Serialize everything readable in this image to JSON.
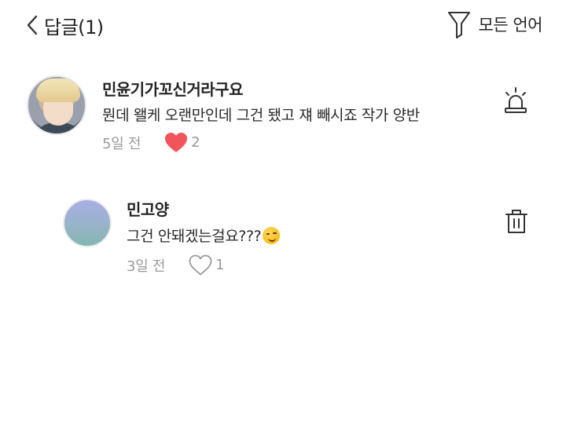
{
  "header": {
    "title": "답글(1)",
    "back_icon": "chevron-left-icon",
    "filter_icon": "filter-icon",
    "language_filter_label": "모든 언어"
  },
  "comments": [
    {
      "username": "민윤기가꼬신거라구요",
      "text": "뭔데 왤케 오랜만인데 그건 됐고 쟤 빼시죠 작가 양반",
      "time": "5일 전",
      "likes": "2",
      "liked": true,
      "action_icon": "report-siren-icon",
      "avatar": "profile-photo"
    }
  ],
  "replies": [
    {
      "username": "민고양",
      "text": "그건 안돼겠는걸요???",
      "emoji": "smirk-emoji",
      "time": "3일 전",
      "likes": "1",
      "liked": false,
      "action_icon": "trash-icon",
      "avatar": "gradient-avatar"
    }
  ],
  "colors": {
    "liked_heart": "#f2545b",
    "meta_text": "#9a9a9a",
    "primary_text": "#222222"
  }
}
